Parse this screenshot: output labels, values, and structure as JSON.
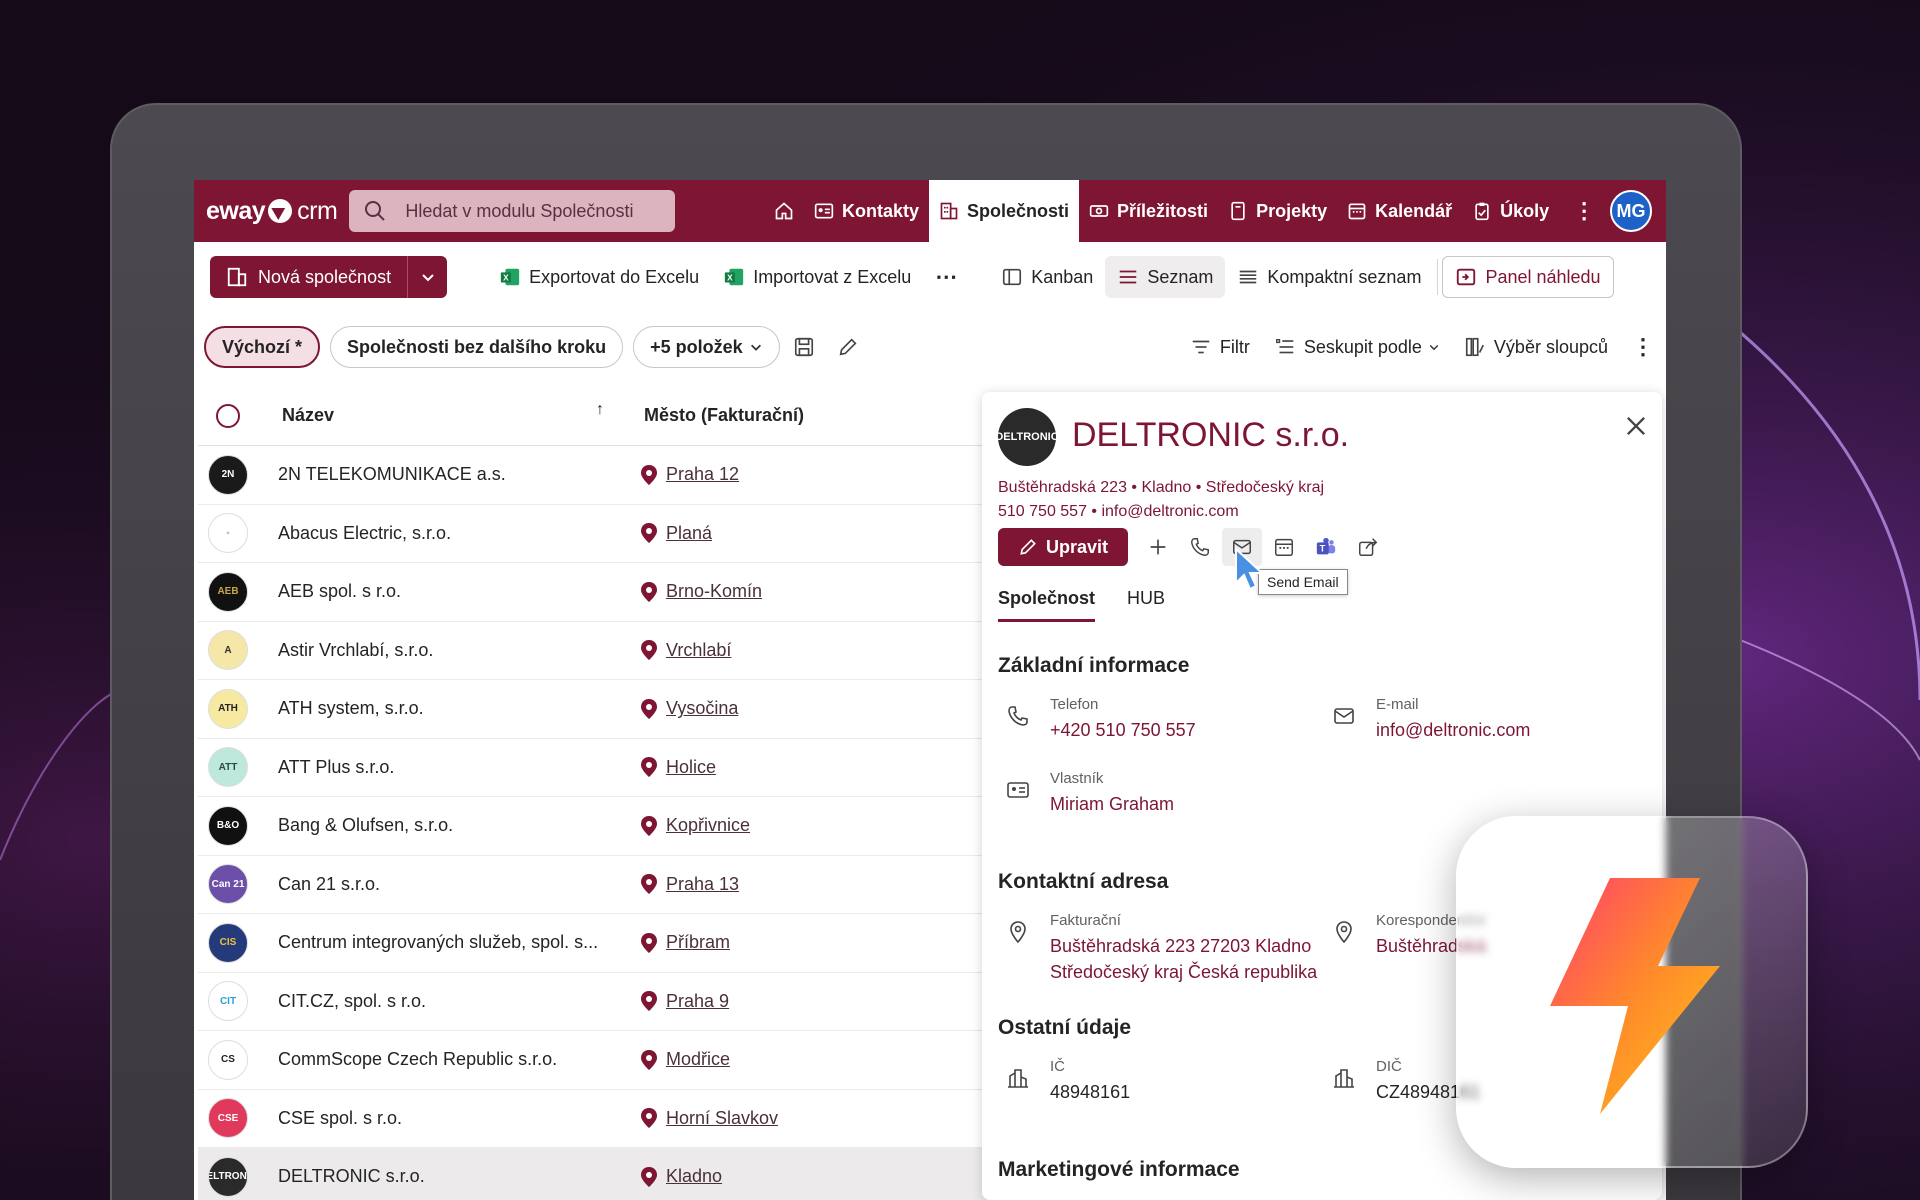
{
  "app": {
    "logo_word": "eway",
    "logo_crm": "crm"
  },
  "search": {
    "placeholder": "Hledat v modulu Společnosti"
  },
  "nav": [
    {
      "label": "Kontakty"
    },
    {
      "label": "Společnosti"
    },
    {
      "label": "Příležitosti"
    },
    {
      "label": "Projekty"
    },
    {
      "label": "Kalendář"
    },
    {
      "label": "Úkoly"
    }
  ],
  "user": {
    "initials": "MG"
  },
  "toolbar": {
    "new_label": "Nová společnost",
    "export_label": "Exportovat do Excelu",
    "import_label": "Importovat z Excelu",
    "more": "⋯",
    "kanban_label": "Kanban",
    "list_label": "Seznam",
    "compact_label": "Kompaktní seznam",
    "preview_label": "Panel náhledu"
  },
  "filters": {
    "default_label": "Výchozí *",
    "no_next_step_label": "Společnosti bez dalšího kroku",
    "more_label": "+5 položek",
    "filter_label": "Filtr",
    "group_label": "Seskupit podle",
    "columns_label": "Výběr sloupců"
  },
  "grid": {
    "col_name": "Název",
    "col_city": "Město (Fakturační)",
    "sort_indicator": "↑",
    "rows": [
      {
        "name": "2N TELEKOMUNIKACE a.s.",
        "city": "Praha 12",
        "logo": "2N",
        "logo_bg": "#1a1a1a",
        "logo_fg": "#ffffff"
      },
      {
        "name": "Abacus Electric, s.r.o.",
        "city": "Planá",
        "logo": "◦",
        "logo_bg": "#ffffff",
        "logo_fg": "#2a7fb0"
      },
      {
        "name": "AEB spol. s r.o.",
        "city": "Brno-Komín",
        "logo": "AEB",
        "logo_bg": "#111111",
        "logo_fg": "#c9a24a"
      },
      {
        "name": "Astir Vrchlabí, s.r.o.",
        "city": "Vrchlabí",
        "logo": "A",
        "logo_bg": "#f5e7a8",
        "logo_fg": "#333333"
      },
      {
        "name": "ATH system, s.r.o.",
        "city": "Vysočina",
        "logo": "ATH",
        "logo_bg": "#f7eaa0",
        "logo_fg": "#222222"
      },
      {
        "name": "ATT Plus s.r.o.",
        "city": "Holice",
        "logo": "ATT",
        "logo_bg": "#bfe8dc",
        "logo_fg": "#2a4a44"
      },
      {
        "name": "Bang & Olufsen, s.r.o.",
        "city": "Kopřivnice",
        "logo": "B&O",
        "logo_bg": "#111111",
        "logo_fg": "#ffffff"
      },
      {
        "name": "Can 21 s.r.o.",
        "city": "Praha 13",
        "logo": "Can 21",
        "logo_bg": "#6b4fa8",
        "logo_fg": "#ffffff"
      },
      {
        "name": "Centrum integrovaných služeb, spol. s...",
        "city": "Příbram",
        "logo": "CIS",
        "logo_bg": "#243a7a",
        "logo_fg": "#f0c040"
      },
      {
        "name": "CIT.CZ, spol. s r.o.",
        "city": "Praha 9",
        "logo": "CIT",
        "logo_bg": "#ffffff",
        "logo_fg": "#2aa0d8"
      },
      {
        "name": "CommScope Czech Republic s.r.o.",
        "city": "Modřice",
        "logo": "CS",
        "logo_bg": "#ffffff",
        "logo_fg": "#222222"
      },
      {
        "name": "CSE spol. s r.o.",
        "city": "Horní Slavkov",
        "logo": "CSE",
        "logo_bg": "#e0395c",
        "logo_fg": "#ffffff"
      },
      {
        "name": "DELTRONIC s.r.o.",
        "city": "Kladno",
        "logo": "DELTRONIC",
        "logo_bg": "#2a2a2a",
        "logo_fg": "#ffffff"
      }
    ]
  },
  "detail": {
    "logo": "DELTRONIC",
    "title": "DELTRONIC s.r.o.",
    "address_line": "Buštěhradská 223 • Kladno • Středočeský kraj",
    "contact_line": "510 750 557 • info@deltronic.com",
    "edit_label": "Upravit",
    "tooltip": "Send Email",
    "tabs": [
      "Společnost",
      "HUB"
    ],
    "section_basic": "Základní informace",
    "phone_label": "Telefon",
    "phone_value": "+420 510 750 557",
    "email_label": "E-mail",
    "email_value": "info@deltronic.com",
    "owner_label": "Vlastník",
    "owner_value": "Miriam Graham",
    "section_address": "Kontaktní adresa",
    "billing_label": "Fakturační",
    "billing_line1": "Buštěhradská 223 27203 Kladno",
    "billing_line2": "Středočeský kraj Česká republika",
    "corr_label": "Korespondenční",
    "corr_value": "Buštěhradská",
    "section_other": "Ostatní údaje",
    "ic_label": "IČ",
    "ic_value": "48948161",
    "dic_label": "DIČ",
    "dic_value": "CZ48948161",
    "section_marketing": "Marketingové informace"
  },
  "colors": {
    "brand": "#7d1533",
    "avatar": "#1f62c7"
  }
}
